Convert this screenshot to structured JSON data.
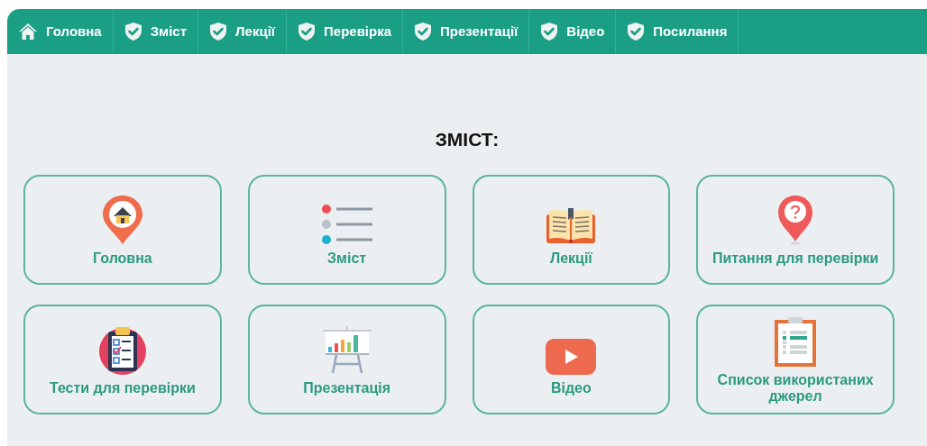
{
  "nav": {
    "items": [
      {
        "label": "Головна"
      },
      {
        "label": "Зміст"
      },
      {
        "label": "Лекції"
      },
      {
        "label": "Перевірка"
      },
      {
        "label": "Презентації"
      },
      {
        "label": "Відео"
      },
      {
        "label": "Посилання"
      }
    ]
  },
  "heading": "ЗМІСТ:",
  "cards": [
    {
      "label": "Головна"
    },
    {
      "label": "Зміст"
    },
    {
      "label": "Лекції"
    },
    {
      "label": "Питання для перевірки"
    },
    {
      "label": "Тести для перевірки"
    },
    {
      "label": "Презентація"
    },
    {
      "label": "Відео"
    },
    {
      "label": "Список використаних джерел"
    }
  ]
}
